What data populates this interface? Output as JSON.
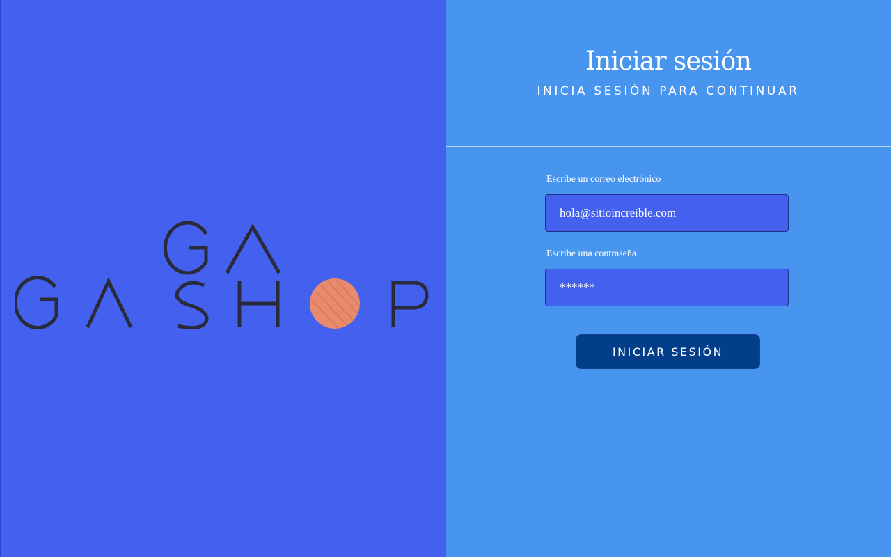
{
  "brand": {
    "logo_line1": "GA",
    "logo_line2": "GA SHOP"
  },
  "login": {
    "title": "Iniciar sesión",
    "subtitle": "INICIA SESIÓN PARA CONTINUAR",
    "email_label": "Escribe un correo electrónico",
    "email_value": "hola@sitioincreible.com",
    "password_label": "Escribe una contraseña",
    "password_value": "******",
    "submit_label": "INICIAR SESIÓN"
  },
  "colors": {
    "left_panel": "#4361ee",
    "right_panel": "#4895ef",
    "button": "#023e8a",
    "logo_dot": "#e88a6c"
  }
}
